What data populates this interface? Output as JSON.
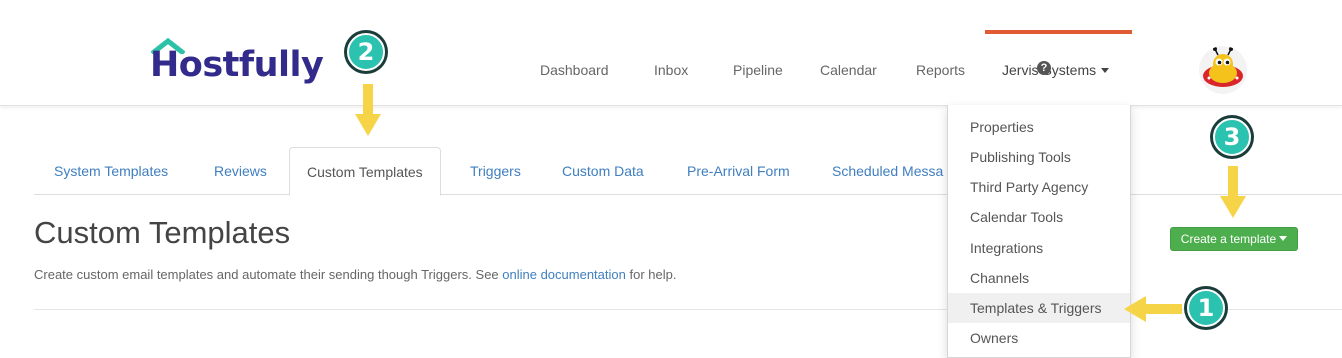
{
  "brand": {
    "name": "Hostfully",
    "color": "#322b8c",
    "roof_color": "#2cc2a8"
  },
  "nav": {
    "items": [
      "Dashboard",
      "Inbox",
      "Pipeline",
      "Calendar",
      "Reports"
    ],
    "account_label": "Jervis Systems",
    "active_color": "#e05a34",
    "help_icon": "question-circle-icon"
  },
  "tabs": [
    {
      "label": "System Templates",
      "active": false
    },
    {
      "label": "Reviews",
      "active": false
    },
    {
      "label": "Custom Templates",
      "active": true
    },
    {
      "label": "Triggers",
      "active": false
    },
    {
      "label": "Custom Data",
      "active": false
    },
    {
      "label": "Pre-Arrival Form",
      "active": false
    },
    {
      "label": "Scheduled Messa",
      "active": false
    }
  ],
  "page": {
    "title": "Custom Templates",
    "desc_before": "Create custom email templates and automate their sending though Triggers. See ",
    "desc_link": "online documentation",
    "desc_after": " for help.",
    "create_button": "Create a template"
  },
  "dropdown": {
    "items": [
      "Properties",
      "Publishing Tools",
      "Third Party Agency",
      "Calendar Tools",
      "Integrations",
      "Channels",
      "Templates & Triggers",
      "Owners"
    ],
    "highlighted": "Templates & Triggers"
  },
  "annotations": {
    "badge_1": "1",
    "badge_2": "2",
    "badge_3": "3",
    "arrow_color": "#f5d547",
    "badge_color": "#2cc2b0"
  }
}
